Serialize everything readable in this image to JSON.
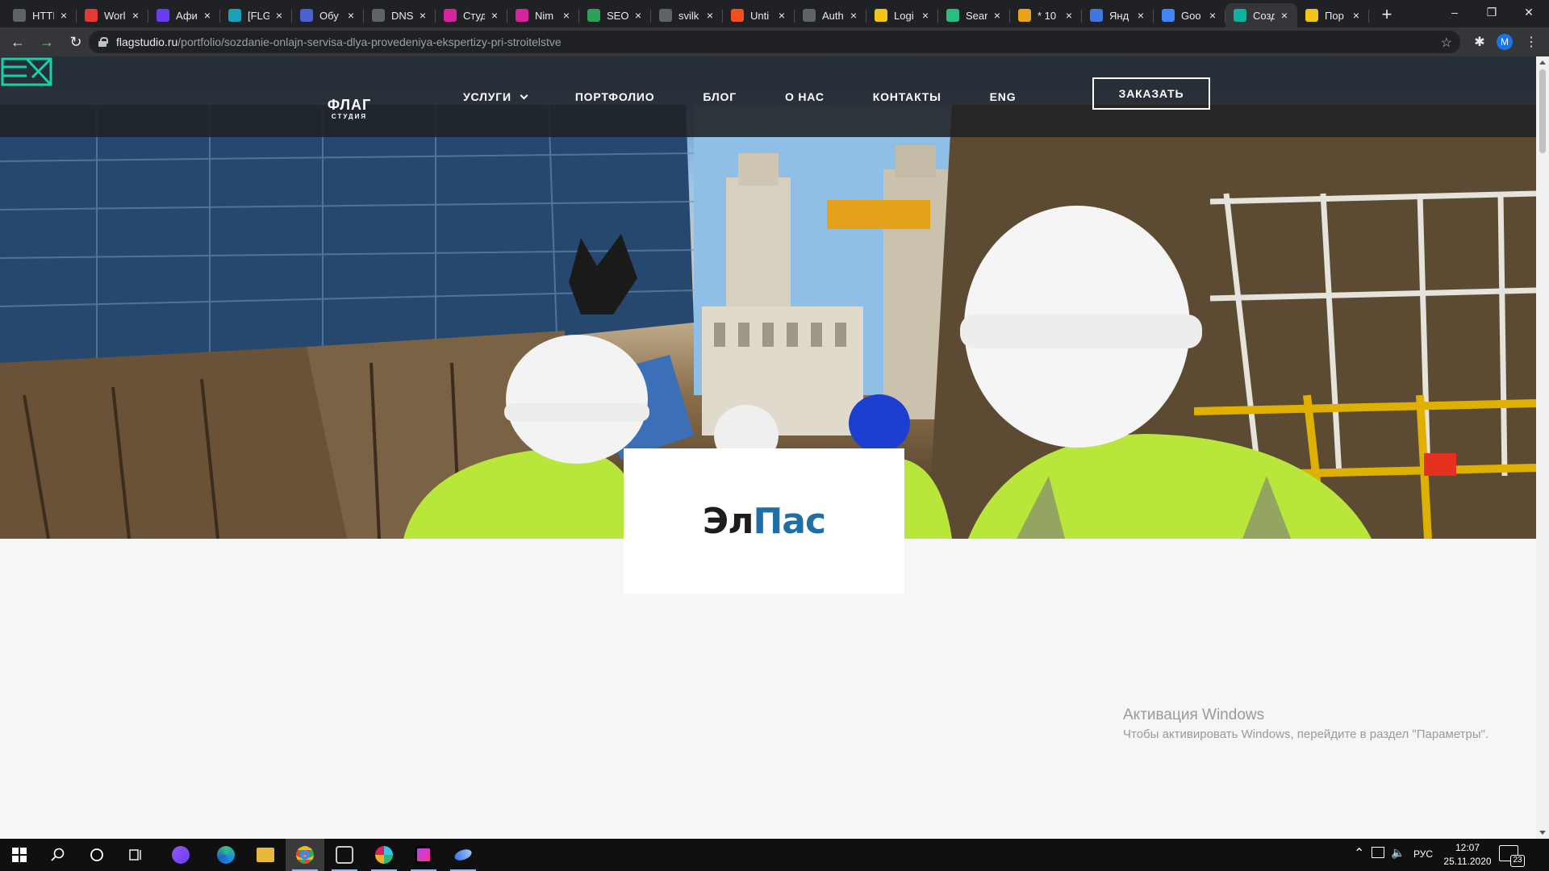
{
  "browser": {
    "tabs": [
      {
        "title": "HTTI",
        "favicon": "globe-icon",
        "color": "#5f6368"
      },
      {
        "title": "Worl",
        "favicon": "s-logo-icon",
        "color": "#e53935"
      },
      {
        "title": "Афи",
        "favicon": "c-circle-icon",
        "color": "#6a3df5"
      },
      {
        "title": "[FLG",
        "favicon": "flg-icon",
        "color": "#1aa1b8"
      },
      {
        "title": "Обу",
        "favicon": "s-badge-icon",
        "color": "#4c5fd5"
      },
      {
        "title": "DNS",
        "favicon": "globe-icon",
        "color": "#5f6368"
      },
      {
        "title": "Студ",
        "favicon": "instagram-icon",
        "color": "#d6249f"
      },
      {
        "title": "Nim",
        "favicon": "instagram-icon",
        "color": "#d6249f"
      },
      {
        "title": "SEO",
        "favicon": "arrow-badge-icon",
        "color": "#2e9e5b"
      },
      {
        "title": "svilk",
        "favicon": "globe-icon",
        "color": "#5f6368"
      },
      {
        "title": "Unti",
        "favicon": "figma-icon",
        "color": "#f24e1e"
      },
      {
        "title": "Auth",
        "favicon": "globe-icon",
        "color": "#5f6368"
      },
      {
        "title": "Logi",
        "favicon": "w-badge-icon",
        "color": "#f0c419"
      },
      {
        "title": "Sear",
        "favicon": "v-logo-icon",
        "color": "#2bbd7e"
      },
      {
        "title": "* 10",
        "favicon": "mail-icon",
        "color": "#e8a317"
      },
      {
        "title": "Янд",
        "favicon": "yandex-browser-icon",
        "color": "#3e77e0"
      },
      {
        "title": "Goo",
        "favicon": "google-translate-icon",
        "color": "#4285f4"
      },
      {
        "title": "Созд",
        "favicon": "flag-studio-icon",
        "color": "#0fb39b"
      },
      {
        "title": "Пор",
        "favicon": "w-badge-icon",
        "color": "#f0c419"
      }
    ],
    "active_tab_index": 17,
    "new_tab_symbol": "+",
    "url_host": "flagstudio.ru",
    "url_path": "/portfolio/sozdanie-onlajn-servisa-dlya-provedeniya-ekspertizy-pri-stroitelstve",
    "profile_initial": "M"
  },
  "site": {
    "logo_word": "ФЛАГ",
    "logo_sub": "СТУДИЯ",
    "nav": [
      {
        "label": "УСЛУГИ",
        "has_dropdown": true
      },
      {
        "label": "ПОРТФОЛИО"
      },
      {
        "label": "БЛОГ"
      },
      {
        "label": "О НАС"
      },
      {
        "label": "КОНТАКТЫ"
      },
      {
        "label": "ENG"
      }
    ],
    "order_button": "ЗАКАЗАТЬ",
    "client_logo_part1": "Эл",
    "client_logo_part2": "Пас"
  },
  "activation": {
    "title": "Активация Windows",
    "text": "Чтобы активировать Windows, перейдите в раздел \"Параметры\"."
  },
  "taskbar": {
    "language": "РУС",
    "time": "12:07",
    "date": "25.11.2020",
    "notification_count": "23",
    "apps": [
      "start-icon",
      "search-icon",
      "cortana-icon",
      "task-view-icon",
      "alice-icon",
      "edge-icon",
      "file-explorer-icon",
      "chrome-icon",
      "editor-icon",
      "slack-icon",
      "phpstorm-icon",
      "yandex-browser-icon"
    ]
  }
}
